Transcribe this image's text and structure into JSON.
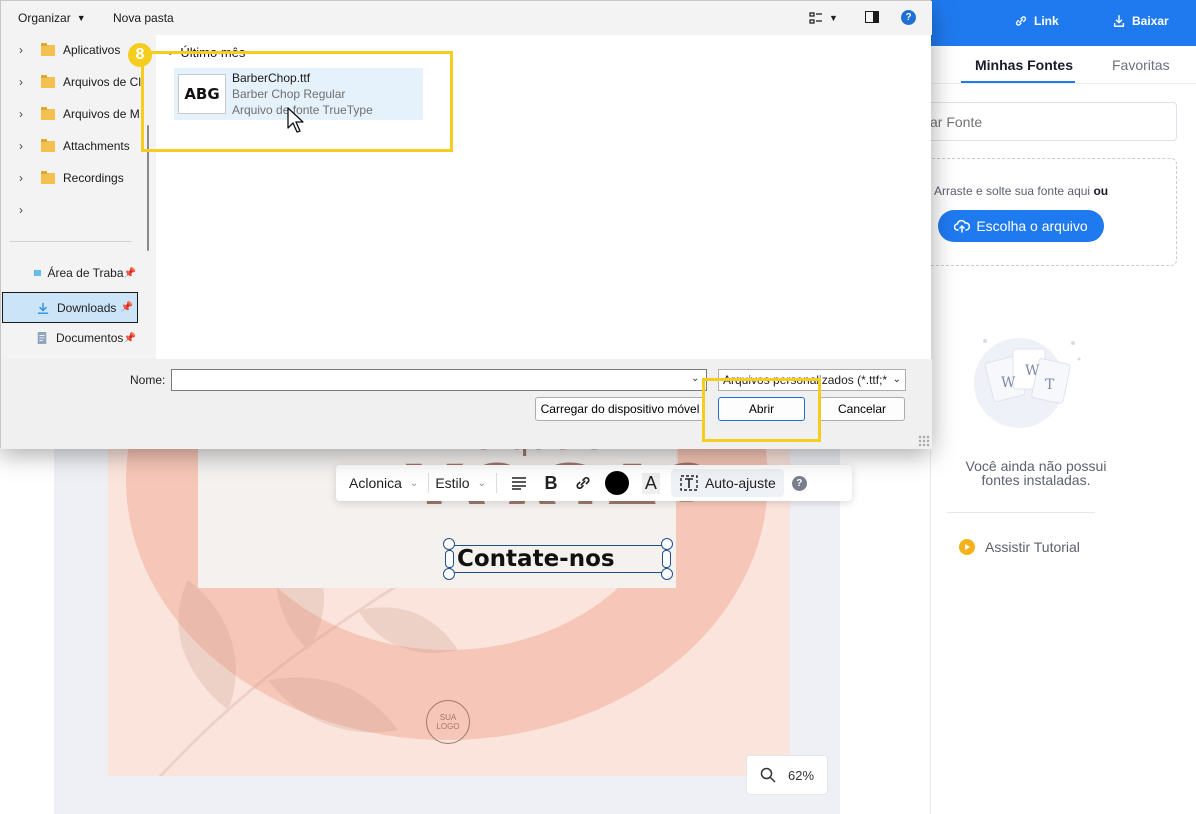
{
  "app": {
    "top_actions": {
      "link_label": "Link",
      "download_label": "Baixar"
    },
    "fonts_panel": {
      "tab_mine": "Minhas Fontes",
      "tab_favorites": "Favoritas",
      "search_placeholder": "ar Fonte",
      "dropzone_text": "Arraste e solte sua fonte aqui",
      "dropzone_or": "ou",
      "choose_file_label": "Escolha o arquivo",
      "empty_line1": "Você ainda não possui",
      "empty_line2": "fontes instaladas.",
      "tutorial_label": "Assistir Tutorial"
    },
    "canvas": {
      "heading_small": "O que é",
      "heading_big": "YOGA?",
      "selected_text": "Contate-nos",
      "logo_line1": "SUA",
      "logo_line2": "LOGO",
      "zoom": "62%"
    },
    "text_toolbar": {
      "font_name": "Aclonica",
      "style_label": "Estilo",
      "autofit_label": "Auto-ajuste",
      "help": "?"
    }
  },
  "dialog": {
    "toolbar": {
      "organize_label": "Organizar",
      "new_folder_label": "Nova pasta",
      "help": "?"
    },
    "nav_folders": [
      {
        "label": "Aplicativos"
      },
      {
        "label": "Arquivos de Cl"
      },
      {
        "label": "Arquivos de M"
      },
      {
        "label": "Attachments"
      },
      {
        "label": "Recordings"
      }
    ],
    "quick_access": [
      {
        "label": "Área de Traba"
      },
      {
        "label": "Downloads"
      },
      {
        "label": "Documentos"
      }
    ],
    "group_header": "Último mês",
    "file": {
      "thumb": "ABG",
      "name": "BarberChop.ttf",
      "font_title": "Barber Chop Regular",
      "type": "Arquivo de fonte TrueType"
    },
    "name_label": "Nome:",
    "name_value": "",
    "file_filter": "Arquivos personalizados (*.ttf;*",
    "upload_label": "Carregar do dispositivo móvel",
    "open_label": "Abrir",
    "cancel_label": "Cancelar"
  },
  "annotations": {
    "step_number": "8",
    "accent_color": "#f4cd1f"
  },
  "colors": {
    "brand_blue": "#1f7af0",
    "selection_blue": "#e5f1fb"
  }
}
